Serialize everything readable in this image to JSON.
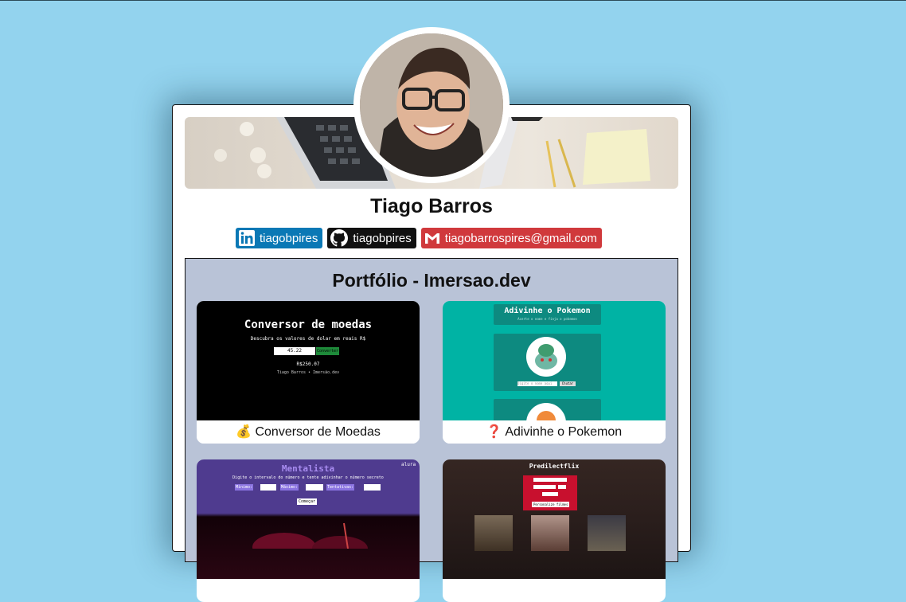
{
  "profile": {
    "name": "Tiago Barros",
    "avatar_icon": "profile-photo"
  },
  "social": {
    "linkedin": {
      "label": "tiagobpires",
      "icon": "linkedin-icon",
      "color": "#0a78b5"
    },
    "github": {
      "label": "tiagobpires",
      "icon": "github-icon",
      "color": "#111111"
    },
    "gmail": {
      "label": "tiagobarrospires@gmail.com",
      "icon": "gmail-icon",
      "color": "#d0393c"
    }
  },
  "portfolio": {
    "title": "Portfólio - Imersao.dev",
    "projects": [
      {
        "label": "💰 Conversor de Moedas",
        "preview": {
          "title": "Conversor de moedas",
          "subtitle": "Descubra os valores de dolar em reais R$",
          "input_value": "45.22",
          "button": "Converter",
          "result": "R$250.07",
          "footer": "Tiago Barros • Imersão.dev"
        }
      },
      {
        "label": "❓ Adivinhe o Pokemon",
        "preview": {
          "title": "Adivinhe o Pokemon",
          "subtitle": "Acerte o nome e finja o pokemon",
          "input_placeholder": "Digite o nome aqui",
          "button": "Chutar"
        }
      },
      {
        "label": "",
        "preview": {
          "title": "Mentalista",
          "brand": "alura",
          "subtitle": "Digite o intervalo do número e tente adivinhar o número secreto",
          "field_min": "Mínimo:",
          "field_max": "Máximo:",
          "field_tries": "Tentativas:",
          "button": "Começar"
        }
      },
      {
        "label": "",
        "preview": {
          "title": "Predilectflix",
          "button": "Personalize filmes"
        }
      }
    ]
  },
  "colors": {
    "background": "#93d3ee",
    "portfolio_bg": "#b9c3d7",
    "pokemon_bg": "#00b3a4"
  }
}
